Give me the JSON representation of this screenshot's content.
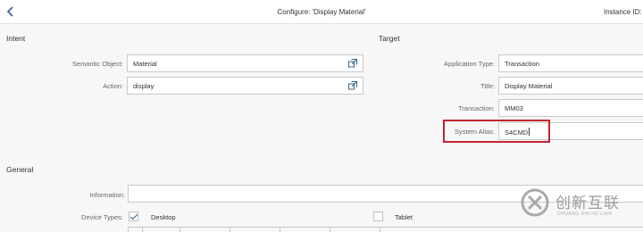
{
  "header": {
    "back_icon": "chevron-left-icon",
    "title": "Configure: 'Display Material'",
    "instance_label": "Instance ID: C"
  },
  "intent": {
    "heading": "Intent",
    "semantic_object": {
      "label": "Semantic Object:",
      "value": "Material"
    },
    "action": {
      "label": "Action:",
      "value": "display"
    },
    "value_help_icon": "external-link-icon"
  },
  "target": {
    "heading": "Target",
    "application_type": {
      "label": "Application Type:",
      "value": "Transaction"
    },
    "title": {
      "label": "Title:",
      "value": "Display Material"
    },
    "transaction": {
      "label": "Transaction:",
      "value": "MM03"
    },
    "system_alias": {
      "label": "System Alias:",
      "value": "S4CMD"
    },
    "highlight_color": "#c0262c"
  },
  "general": {
    "heading": "General",
    "information": {
      "label": "Information:",
      "value": ""
    },
    "device_types": {
      "label": "Device Types:",
      "desktop": {
        "label": "Desktop",
        "checked": true
      },
      "tablet": {
        "label": "Tablet",
        "checked": false
      }
    }
  },
  "watermark": {
    "text": "创新互联",
    "sub": "CHUANG XIN HU LIAN"
  }
}
